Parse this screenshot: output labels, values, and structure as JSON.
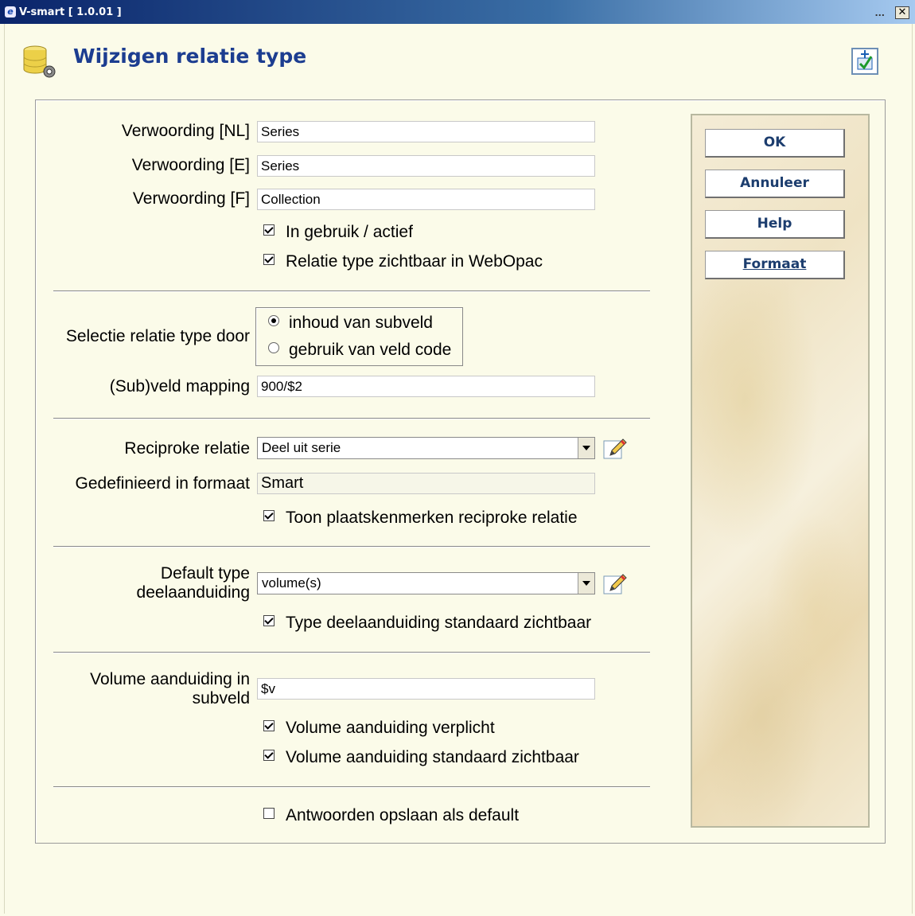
{
  "window": {
    "title": "V-smart [ 1.0.01 ]",
    "minimize_label": "...",
    "close_label": "✕"
  },
  "header": {
    "title": "Wijzigen relatie type"
  },
  "form": {
    "verwoording_nl": {
      "label": "Verwoording [NL]",
      "value": "Series"
    },
    "verwoording_e": {
      "label": "Verwoording [E]",
      "value": "Series"
    },
    "verwoording_f": {
      "label": "Verwoording [F]",
      "value": "Collection"
    },
    "in_gebruik": {
      "label": "In gebruik / actief",
      "checked": true
    },
    "zichtbaar_webopac": {
      "label": "Relatie type zichtbaar in WebOpac",
      "checked": true
    },
    "selectie": {
      "label": "Selectie relatie type door",
      "options": [
        {
          "label": "inhoud van subveld",
          "selected": true
        },
        {
          "label": "gebruik van veld code",
          "selected": false
        }
      ]
    },
    "subveld_mapping": {
      "label": "(Sub)veld mapping",
      "value": "900/$2"
    },
    "reciproke_relatie": {
      "label": "Reciproke relatie",
      "value": "Deel uit serie"
    },
    "gedefinieerd_formaat": {
      "label": "Gedefinieerd in formaat",
      "value": "Smart"
    },
    "toon_plaatskenmerken": {
      "label": "Toon plaatskenmerken reciproke relatie",
      "checked": true
    },
    "default_type": {
      "label": "Default type deelaanduiding",
      "value": "volume(s)"
    },
    "type_zichtbaar": {
      "label": "Type deelaanduiding standaard zichtbaar",
      "checked": true
    },
    "volume_subveld": {
      "label": "Volume aanduiding in subveld",
      "value": "$v"
    },
    "volume_verplicht": {
      "label": "Volume aanduiding verplicht",
      "checked": true
    },
    "volume_zichtbaar": {
      "label": "Volume aanduiding standaard zichtbaar",
      "checked": true
    },
    "antwoorden_opslaan": {
      "label": "Antwoorden opslaan als default",
      "checked": false
    }
  },
  "buttons": {
    "ok": "OK",
    "annuleer": "Annuleer",
    "help": "Help",
    "formaat": "Formaat"
  }
}
